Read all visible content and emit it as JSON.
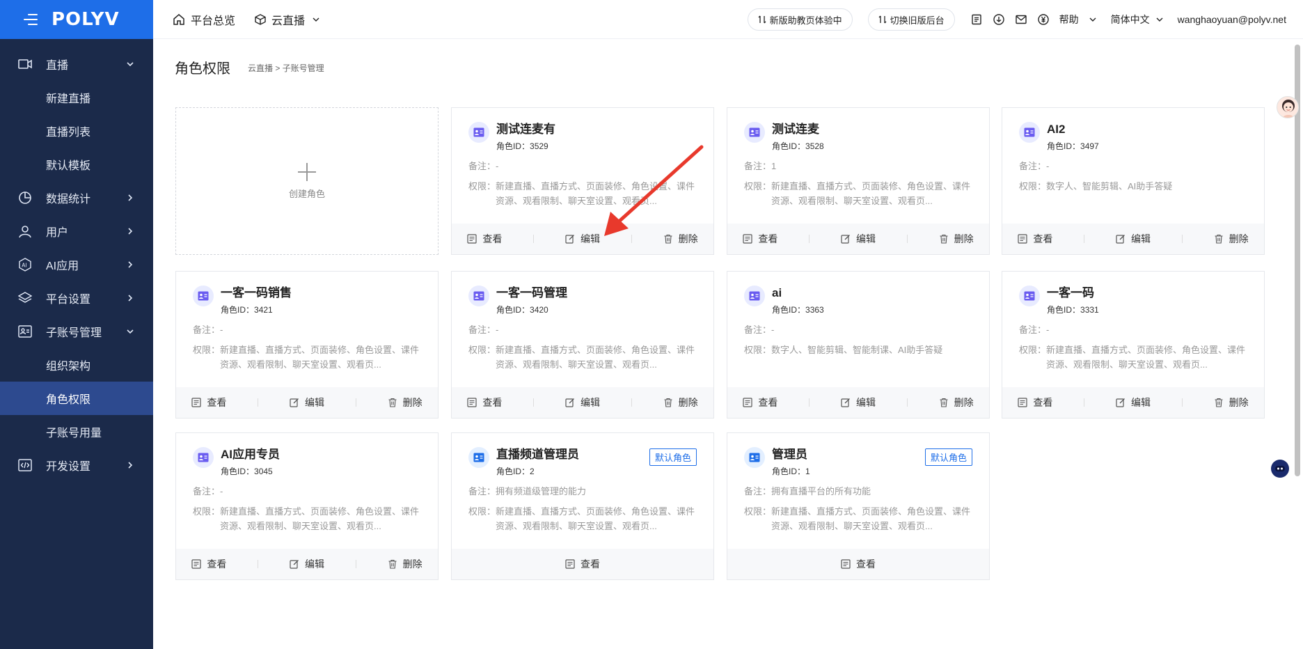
{
  "app": {
    "logo": "POLYV"
  },
  "sidebar": {
    "items": [
      {
        "label": "直播",
        "icon": "video-icon",
        "expanded": true
      },
      {
        "label": "新建直播",
        "sub": true
      },
      {
        "label": "直播列表",
        "sub": true
      },
      {
        "label": "默认模板",
        "sub": true
      },
      {
        "label": "数据统计",
        "icon": "pie-chart-icon"
      },
      {
        "label": "用户",
        "icon": "user-icon"
      },
      {
        "label": "AI应用",
        "icon": "ai-icon"
      },
      {
        "label": "平台设置",
        "icon": "layers-icon"
      },
      {
        "label": "子账号管理",
        "icon": "id-card-icon",
        "expanded": true
      },
      {
        "label": "组织架构",
        "sub": true
      },
      {
        "label": "角色权限",
        "sub": true,
        "active": true
      },
      {
        "label": "子账号用量",
        "sub": true
      },
      {
        "label": "开发设置",
        "icon": "code-icon"
      }
    ]
  },
  "header": {
    "nav_overview": "平台总览",
    "nav_live": "云直播",
    "pill_new": "新版助教页体验中",
    "pill_old": "切换旧版后台",
    "help": "帮助",
    "language": "简体中文",
    "user_email": "wanghaoyuan@polyv.net"
  },
  "page": {
    "title": "角色权限",
    "breadcrumb": "云直播 > 子账号管理"
  },
  "create_label": "创建角色",
  "labels": {
    "note": "备注：",
    "perm": "权限：",
    "view": "查看",
    "edit": "编辑",
    "delete": "删除",
    "id_prefix": "角色ID："
  },
  "roles": [
    {
      "name": "测试连麦有",
      "id": "3529",
      "note": "-",
      "perm": "新建直播、直播方式、页面装修、角色设置、课件资源、观看限制、聊天室设置、观看页..."
    },
    {
      "name": "测试连麦",
      "id": "3528",
      "note": "1",
      "perm": "新建直播、直播方式、页面装修、角色设置、课件资源、观看限制、聊天室设置、观看页..."
    },
    {
      "name": "AI2",
      "id": "3497",
      "note": "-",
      "perm": "数字人、智能剪辑、AI助手答疑"
    },
    {
      "name": "一客一码销售",
      "id": "3421",
      "note": "-",
      "perm": "新建直播、直播方式、页面装修、角色设置、课件资源、观看限制、聊天室设置、观看页..."
    },
    {
      "name": "一客一码管理",
      "id": "3420",
      "note": "-",
      "perm": "新建直播、直播方式、页面装修、角色设置、课件资源、观看限制、聊天室设置、观看页..."
    },
    {
      "name": "ai",
      "id": "3363",
      "note": "-",
      "perm": "数字人、智能剪辑、智能制课、AI助手答疑"
    },
    {
      "name": "一客一码",
      "id": "3331",
      "note": "-",
      "perm": "新建直播、直播方式、页面装修、角色设置、课件资源、观看限制、聊天室设置、观看页..."
    },
    {
      "name": "AI应用专员",
      "id": "3045",
      "note": "-",
      "perm": "新建直播、直播方式、页面装修、角色设置、课件资源、观看限制、聊天室设置、观看页..."
    },
    {
      "name": "直播频道管理员",
      "id": "2",
      "note": "拥有频道级管理的能力",
      "tag": "默认角色",
      "perm": "新建直播、直播方式、页面装修、角色设置、课件资源、观看限制、聊天室设置、观看页..."
    },
    {
      "name": "管理员",
      "id": "1",
      "note": "拥有直播平台的所有功能",
      "tag": "默认角色",
      "perm": "新建直播、直播方式、页面装修、角色设置、课件资源、观看限制、聊天室设置、观看页..."
    }
  ],
  "colors": {
    "sidebar_bg": "#1b2a4a",
    "brand": "#1e6ee8",
    "active_item": "#2d4a8f",
    "annotation_arrow": "#e8392c"
  }
}
